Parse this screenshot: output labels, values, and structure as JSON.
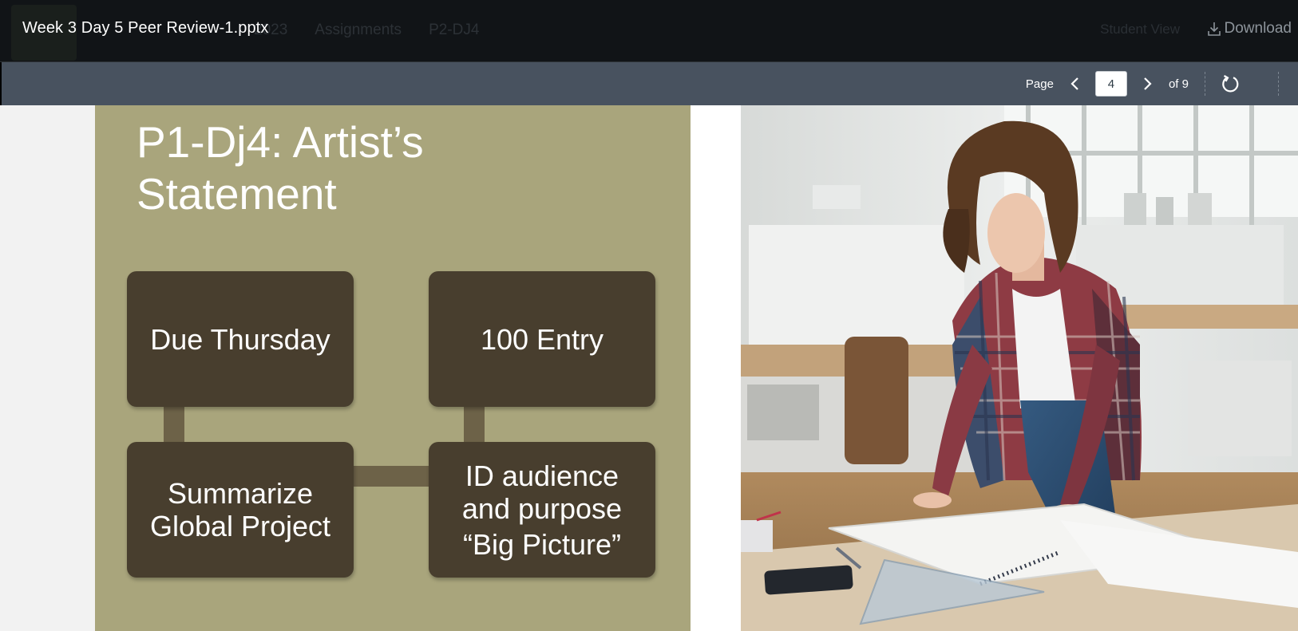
{
  "window": {
    "file_title": "Week 3 Day 5 Peer Review-1.pptx",
    "download_label": "Download"
  },
  "background_nav": {
    "items": [
      "2023",
      "Assignments",
      "P2-DJ4"
    ],
    "right_items": [
      "Student View"
    ]
  },
  "toolbar": {
    "page_label": "Page",
    "current_page": "4",
    "total_label": "of 9"
  },
  "slide": {
    "title_line1": "P1-Dj4: Artist’s",
    "title_line2": "Statement",
    "boxes": {
      "due": "Due Thursday",
      "entry": "100 Entry",
      "summarize": "Summarize\nGlobal Project",
      "audience": "ID audience\nand purpose",
      "audience_sub": "“Big Picture”"
    },
    "photo_description_icon": "woman-drafting-photo"
  },
  "colors": {
    "titlebar_bg": "#111417",
    "toolbar_bg": "#48525f",
    "slide_bg": "#a9a57c",
    "box_bg": "#483e2e",
    "connector": "#6d6248"
  }
}
